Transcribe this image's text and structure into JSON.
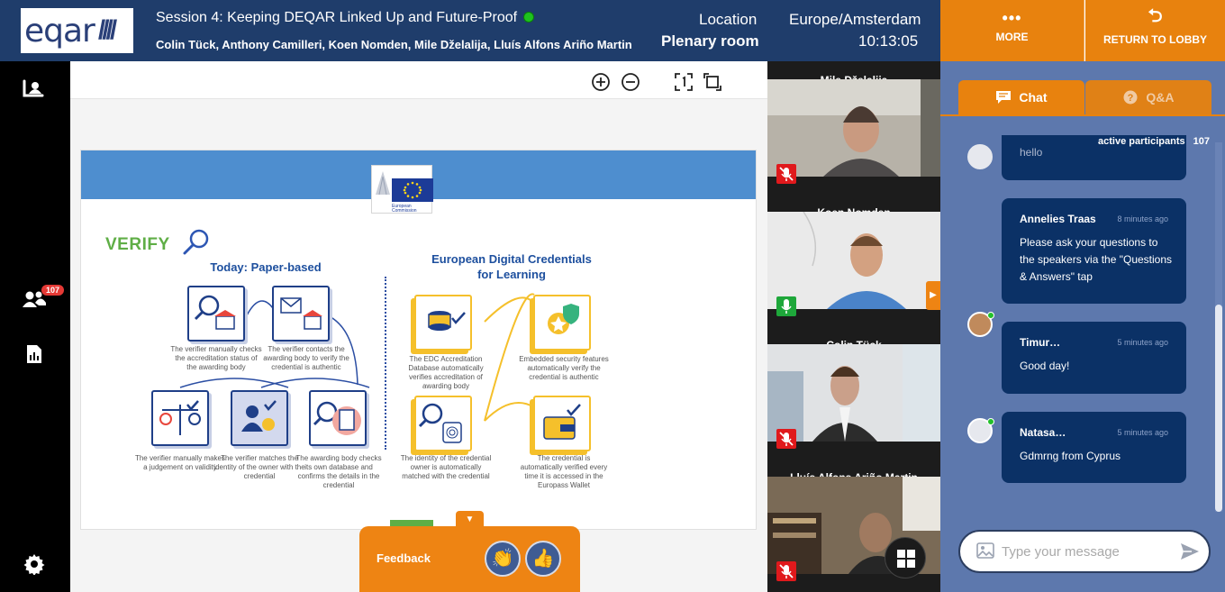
{
  "header": {
    "logo_text": "eqar",
    "session_title": "Session 4: Keeping DEQAR Linked Up and Future-Proof",
    "speakers": "Colin Tück, Anthony Camilleri, Koen Nomden, Mile Dželalija, Lluís Alfons Ariño Martin",
    "location_label": "Location",
    "location_value": "Plenary room",
    "timezone": "Europe/Amsterdam",
    "time": "10:13:05",
    "more_icon": "•••",
    "more_label": "MORE",
    "lobby_icon": "⮌",
    "lobby_label": "RETURN TO LOBBY"
  },
  "sidebar": {
    "participants_badge": "107"
  },
  "slide": {
    "ec_text": "European Commission",
    "verify_label": "VERIFY",
    "left_title": "Today: Paper-based",
    "right_title": "European Digital Credentials for Learning",
    "captions": [
      "The verifier manually checks the accreditation status of the awarding body",
      "The verifier contacts the awarding body to verify the credential is authentic",
      "The verifier manually makes a judgement on validity",
      "The verifier matches the identity of the owner with the credential",
      "The awarding body checks its own database and confirms the details in the credential",
      "The EDC Accreditation Database automatically verifies accreditation of awarding body",
      "Embedded security features automatically verify the credential is authentic",
      "The identity of the credential owner is automatically matched with the credential",
      "The credential is automatically verified every time it is accessed in the Europass Wallet"
    ]
  },
  "feedback": {
    "label": "Feedback",
    "toggle_icon": "▼",
    "clap_icon": "👏",
    "thumb_icon": "👍"
  },
  "videos": [
    {
      "name": "Mile Dželalija",
      "mic": "muted"
    },
    {
      "name": "Koen Nomden",
      "mic": "on"
    },
    {
      "name": "Colin Tück",
      "mic": "muted"
    },
    {
      "name": "Lluís Alfons Ariño Martin",
      "mic": "muted"
    }
  ],
  "video_nav_icon": "▶",
  "chat": {
    "tab_chat": "Chat",
    "tab_qa": "Q&A",
    "active_participants_label": "active participants",
    "active_participants_count": "107",
    "messages": [
      {
        "author": "",
        "ago": "",
        "text": "hello"
      },
      {
        "author": "Annelies Traas",
        "ago": "8 minutes ago",
        "text": "Please ask your questions to the speakers via the \"Questions & Answers\" tap"
      },
      {
        "author": "Timur…",
        "ago": "5 minutes ago",
        "text": "Good day!"
      },
      {
        "author": "Natasa…",
        "ago": "5 minutes ago",
        "text": "Gdmrng from Cyprus"
      }
    ],
    "input_placeholder": "Type your message"
  },
  "colors": {
    "header_bg": "#1f3d6b",
    "accent_orange": "#e8820e",
    "chat_bg": "#5d78ad",
    "message_bg": "#0b3166"
  }
}
